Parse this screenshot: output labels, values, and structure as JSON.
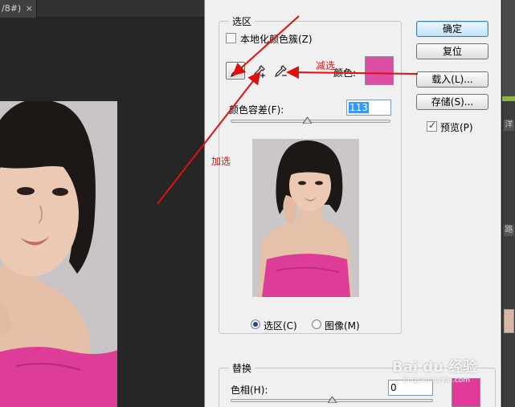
{
  "workspace": {
    "doc_tab_label": "/8#)",
    "doc_tab_close": "×"
  },
  "dialog": {
    "selection_group": {
      "legend": "选区",
      "localized_clusters": {
        "label": "本地化颜色簇(Z)",
        "checked": false
      },
      "color_label": "颜色:",
      "color_swatch": "#dd4fa4",
      "fuzziness_label": "颜色容差(F):",
      "fuzziness_value": "113",
      "fuzziness_level_percent": 48,
      "radio_selection": {
        "label": "选区(C)",
        "checked": true
      },
      "radio_image": {
        "label": "图像(M)",
        "checked": false
      }
    },
    "buttons": {
      "ok": "确定",
      "reset": "复位",
      "load": "载入(L)...",
      "save": "存储(S)..."
    },
    "preview": {
      "label": "预览(P)",
      "checked": true
    },
    "replace_group": {
      "legend": "替换",
      "hue_label": "色相(H):",
      "hue_value": "0",
      "hue_level_percent": 50,
      "result_swatch": "#e0399a"
    }
  },
  "panel_strip": {
    "chips": [
      "洋",
      "路"
    ]
  },
  "annotations": {
    "subtract_label": "减选",
    "add_label": "加选",
    "arrow_color": "#e01010"
  },
  "watermark": {
    "main": "Bai du 经验",
    "sub": "jingyan.baidu.com"
  },
  "colors": {
    "dialog_bg": "#f0f0f0",
    "workspace_bg": "#282828",
    "photo_bg": "#c9c4c6",
    "magenta": "#dd3c98",
    "hair": "#1d1716",
    "skin": "#e8c3ac"
  }
}
